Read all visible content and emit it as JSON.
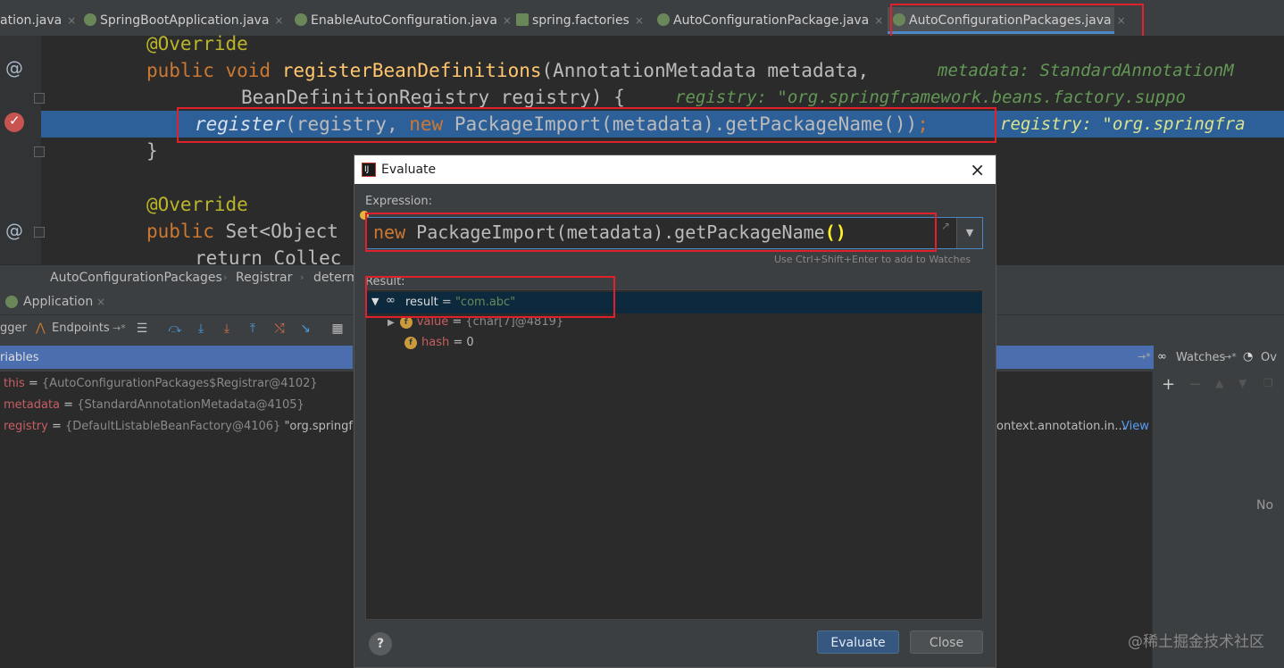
{
  "tabs": [
    {
      "label": "ation.java"
    },
    {
      "label": "SpringBootApplication.java"
    },
    {
      "label": "EnableAutoConfiguration.java"
    },
    {
      "label": "spring.factories"
    },
    {
      "label": "AutoConfigurationPackage.java"
    },
    {
      "label": "AutoConfigurationPackages.java"
    }
  ],
  "tab_close_glyph": "×",
  "editor": {
    "line1": "@Override",
    "line2_kw": "public void ",
    "line2_fn": "registerBeanDefinitions",
    "line2_rest": "(AnnotationMetadata metadata,",
    "line2_hint": "metadata: StandardAnnotationM",
    "line3": "BeanDefinitionRegistry registry) {",
    "line3_hint": "registry: \"org.springframework.beans.factory.suppo",
    "line4_fn": "register",
    "line4_a": "(registry, ",
    "line4_kw": "new",
    "line4_b": " PackageImport(metadata).getPackageName())",
    "line4_semi": ";",
    "line4_hint": "registry: \"org.springfra",
    "line5": "}",
    "line7": "@Override",
    "line8_kw": "public",
    "line8_rest": " Set<Object",
    "line9": "return Collec",
    "gutter_at1": "@",
    "gutter_at2": "@"
  },
  "breadcrumb": {
    "item1": "AutoConfigurationPackages",
    "item2": "Registrar",
    "item3": "determ"
  },
  "debug": {
    "run_tab": "Application",
    "toolbar_left": "gger",
    "endpoints": "Endpoints",
    "variables_label": "riables",
    "watches_label": "Watches",
    "ov_label": "Ov",
    "no_label": "No",
    "view_link": "View",
    "registry_suffix": "ontext.annotation.in...",
    "vars": [
      {
        "name": "this",
        "value": "{AutoConfigurationPackages$Registrar@4102}",
        "extra": ""
      },
      {
        "name": "metadata",
        "value": "{StandardAnnotationMetadata@4105}",
        "extra": ""
      },
      {
        "name": "registry",
        "value": "{DefaultListableBeanFactory@4106}",
        "extra": "\"org.springfra"
      }
    ]
  },
  "dialog": {
    "title": "Evaluate",
    "close": "×",
    "expression_label": "Expression:",
    "expr_kw": "new",
    "expr_rest": " PackageImport(metadata).getPackageName",
    "expr_paren": "()",
    "hint": "Use Ctrl+Shift+Enter to add to Watches",
    "result_label": "Result:",
    "result": {
      "name": "result",
      "eq": " = ",
      "value": "\"com.abc\""
    },
    "children": [
      {
        "name": "value",
        "value": "{char[7]@4819}"
      },
      {
        "name": "hash",
        "value": "0"
      }
    ],
    "evaluate_btn": "Evaluate",
    "close_btn": "Close",
    "help": "?"
  },
  "watermark": "@稀土掘金技术社区",
  "colors": {
    "highlight": "#2d6099",
    "redbox": "#e0202a",
    "accent": "#4a88c7"
  }
}
